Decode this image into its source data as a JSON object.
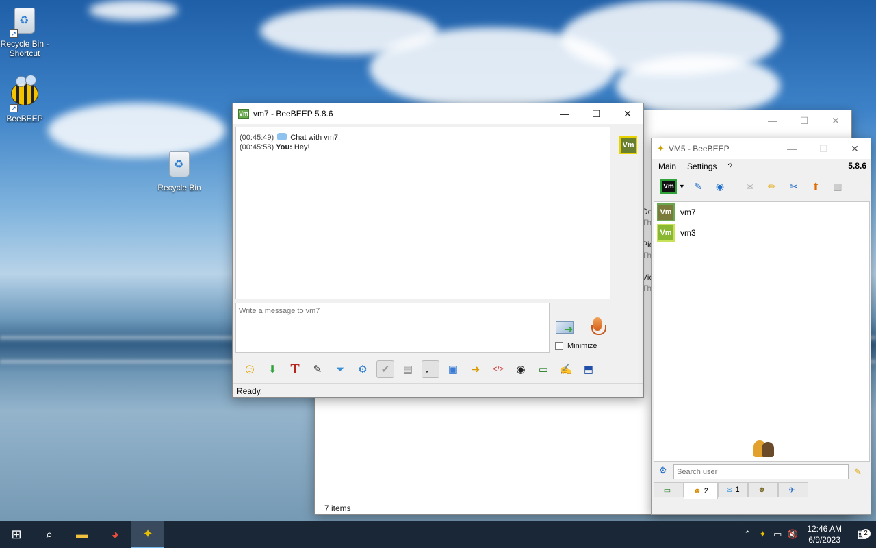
{
  "desktop": {
    "icons": [
      {
        "label": "Recycle Bin - Shortcut"
      },
      {
        "label": "BeeBEEP"
      },
      {
        "label": "Recycle Bin"
      }
    ]
  },
  "background_window": {
    "status": "7 items",
    "side_texts": [
      "Dov",
      "Thi",
      "Pic",
      "Thi",
      "Vid",
      "Thi"
    ]
  },
  "chat_window": {
    "title": "vm7 - BeeBEEP 5.8.6",
    "avatar_text": "Vm",
    "messages": [
      {
        "time": "(00:45:49)",
        "sender": "",
        "text": "Chat with vm7."
      },
      {
        "time": "(00:45:58)",
        "sender": "You:",
        "text": "Hey!"
      }
    ],
    "input_placeholder": "Write a message to vm7",
    "minimize_label": "Minimize",
    "status": "Ready."
  },
  "main_window": {
    "title": "VM5 - BeeBEEP",
    "menu": [
      "Main",
      "Settings",
      "?"
    ],
    "version": "5.8.6",
    "my_avatar": "Vm",
    "users": [
      {
        "avatar": "Vm",
        "name": "vm7"
      },
      {
        "avatar": "Vm",
        "name": "vm3"
      }
    ],
    "search_placeholder": "Search user",
    "tabs": [
      {
        "icon": "monitor-icon",
        "count": ""
      },
      {
        "icon": "users-icon",
        "count": "2"
      },
      {
        "icon": "chat-icon",
        "count": "1"
      },
      {
        "icon": "groups-icon",
        "count": ""
      },
      {
        "icon": "file-share-icon",
        "count": ""
      }
    ]
  },
  "taskbar": {
    "time": "12:46 AM",
    "date": "6/9/2023",
    "notification_count": "2"
  }
}
